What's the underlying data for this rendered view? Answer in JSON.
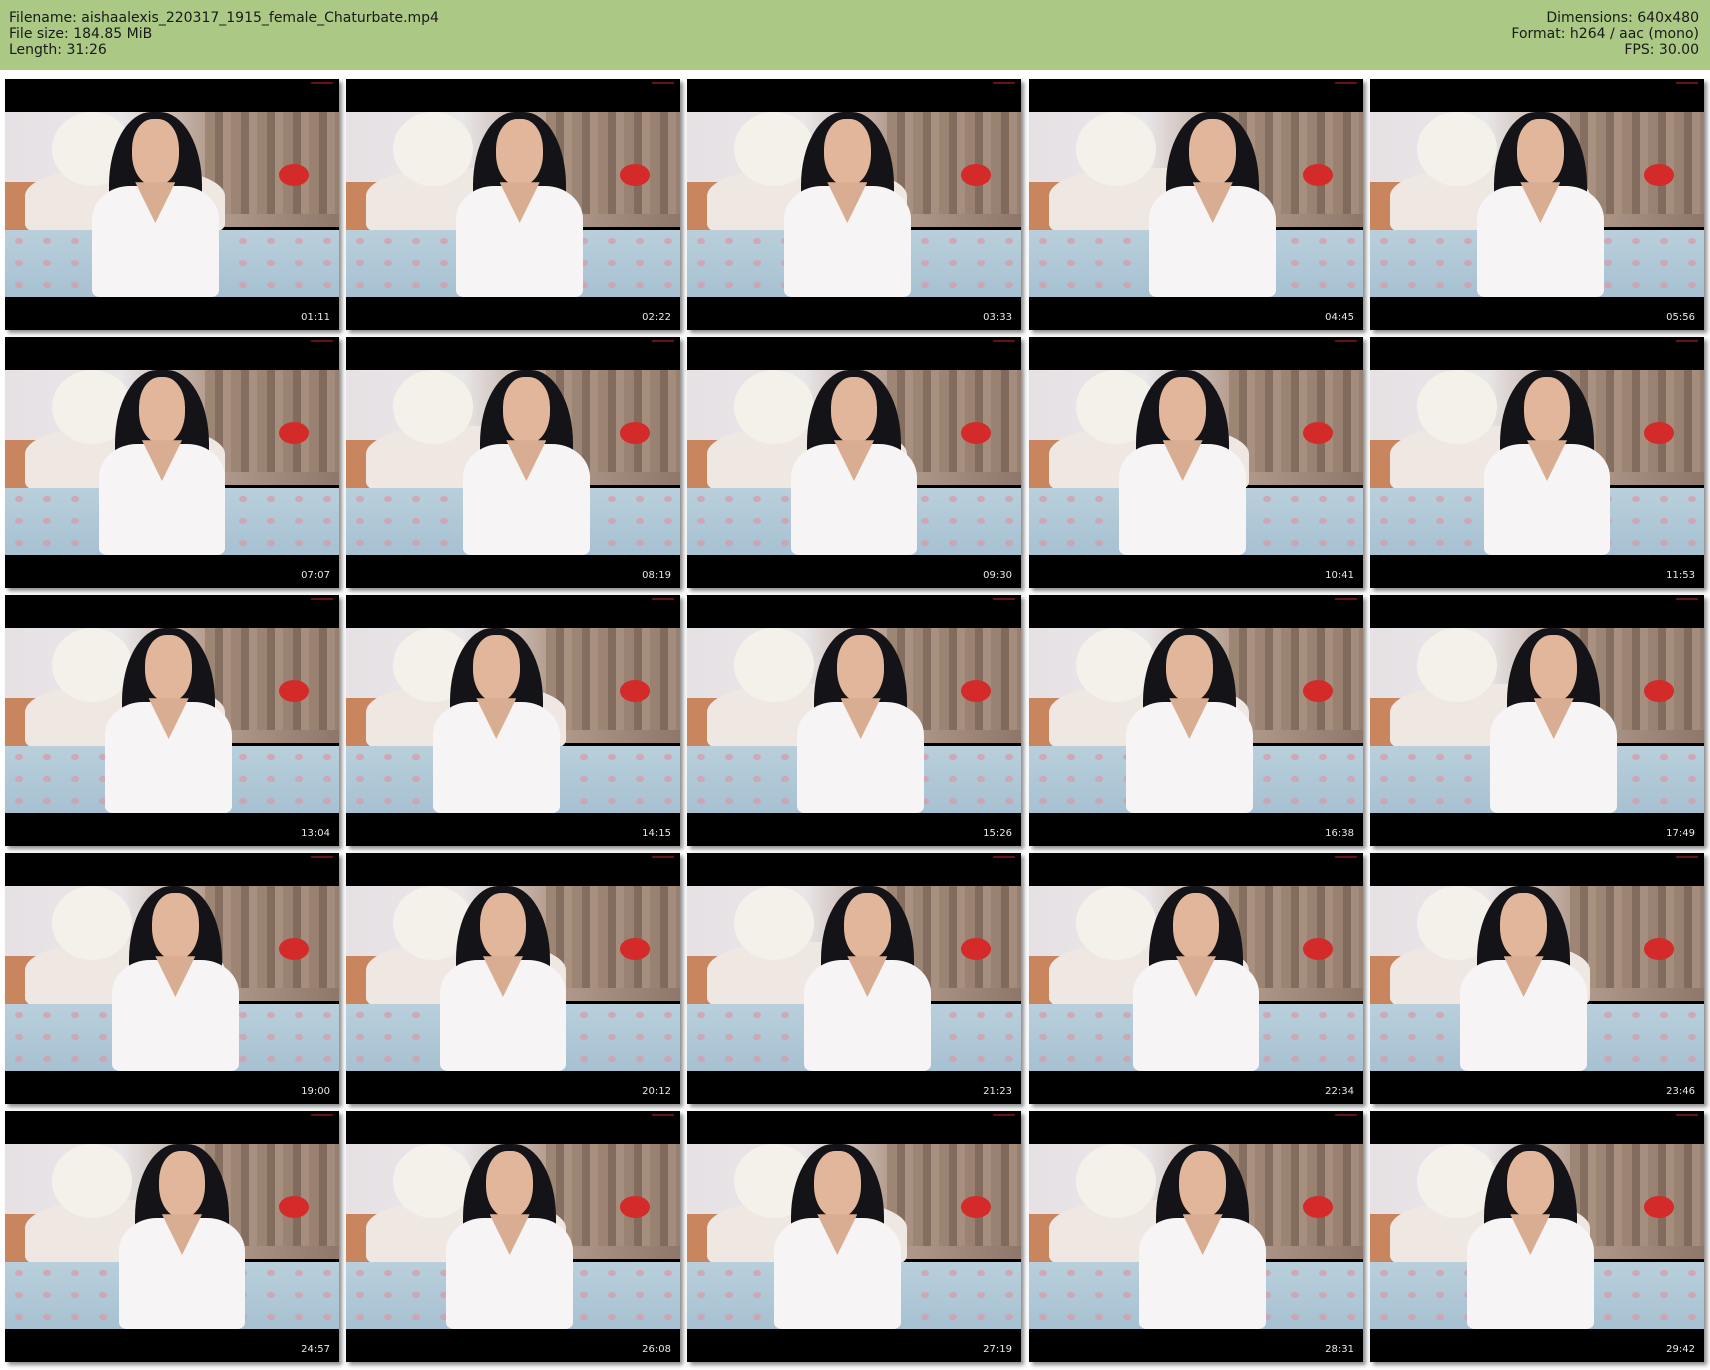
{
  "header": {
    "filename_label": "Filename: aishaalexis_220317_1915_female_Chaturbate.mp4",
    "filesize_label": "File size: 184.85 MiB",
    "length_label": "Length: 31:26",
    "dimensions_label": "Dimensions: 640x480",
    "format_label": "Format: h264 / aac (mono)",
    "fps_label": "FPS: 30.00",
    "background_color": "#abc884"
  },
  "thumbnails": [
    {
      "time": "01:11"
    },
    {
      "time": "02:22"
    },
    {
      "time": "03:33"
    },
    {
      "time": "04:45"
    },
    {
      "time": "05:56"
    },
    {
      "time": "07:07"
    },
    {
      "time": "08:19"
    },
    {
      "time": "09:30"
    },
    {
      "time": "10:41"
    },
    {
      "time": "11:53"
    },
    {
      "time": "13:04"
    },
    {
      "time": "14:15"
    },
    {
      "time": "15:26"
    },
    {
      "time": "16:38"
    },
    {
      "time": "17:49"
    },
    {
      "time": "19:00"
    },
    {
      "time": "20:12"
    },
    {
      "time": "21:23"
    },
    {
      "time": "22:34"
    },
    {
      "time": "23:46"
    },
    {
      "time": "24:57"
    },
    {
      "time": "26:08"
    },
    {
      "time": "27:19"
    },
    {
      "time": "28:31"
    },
    {
      "time": "29:42"
    }
  ]
}
